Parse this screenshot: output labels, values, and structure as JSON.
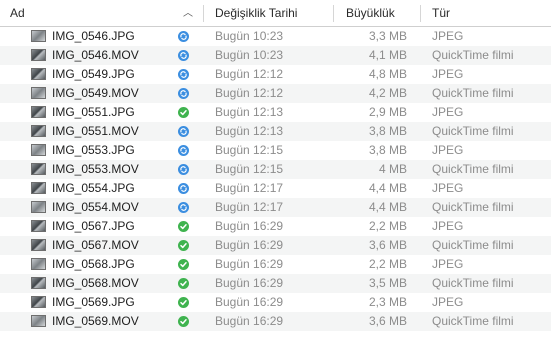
{
  "columns": {
    "name": "Ad",
    "date": "Değişiklik Tarihi",
    "size": "Büyüklük",
    "kind": "Tür",
    "sort_icon": "chevron-up-icon"
  },
  "colors": {
    "sync_blue": "#3b8ee0",
    "synced_green": "#3fb34f",
    "meta_text": "#8c8c8c"
  },
  "files": [
    {
      "name": "IMG_0546.JPG",
      "status": "syncing",
      "date": "Bugün 10:23",
      "size": "3,3 MB",
      "kind": "JPEG"
    },
    {
      "name": "IMG_0546.MOV",
      "status": "syncing",
      "date": "Bugün 10:23",
      "size": "4,1 MB",
      "kind": "QuickTime filmi"
    },
    {
      "name": "IMG_0549.JPG",
      "status": "syncing",
      "date": "Bugün 12:12",
      "size": "4,8 MB",
      "kind": "JPEG"
    },
    {
      "name": "IMG_0549.MOV",
      "status": "syncing",
      "date": "Bugün 12:12",
      "size": "4,2 MB",
      "kind": "QuickTime filmi"
    },
    {
      "name": "IMG_0551.JPG",
      "status": "synced",
      "date": "Bugün 12:13",
      "size": "2,9 MB",
      "kind": "JPEG"
    },
    {
      "name": "IMG_0551.MOV",
      "status": "syncing",
      "date": "Bugün 12:13",
      "size": "3,8 MB",
      "kind": "QuickTime filmi"
    },
    {
      "name": "IMG_0553.JPG",
      "status": "syncing",
      "date": "Bugün 12:15",
      "size": "3,8 MB",
      "kind": "JPEG"
    },
    {
      "name": "IMG_0553.MOV",
      "status": "syncing",
      "date": "Bugün 12:15",
      "size": "4 MB",
      "kind": "QuickTime filmi"
    },
    {
      "name": "IMG_0554.JPG",
      "status": "syncing",
      "date": "Bugün 12:17",
      "size": "4,4 MB",
      "kind": "JPEG"
    },
    {
      "name": "IMG_0554.MOV",
      "status": "syncing",
      "date": "Bugün 12:17",
      "size": "4,4 MB",
      "kind": "QuickTime filmi"
    },
    {
      "name": "IMG_0567.JPG",
      "status": "synced",
      "date": "Bugün 16:29",
      "size": "2,2 MB",
      "kind": "JPEG"
    },
    {
      "name": "IMG_0567.MOV",
      "status": "synced",
      "date": "Bugün 16:29",
      "size": "3,6 MB",
      "kind": "QuickTime filmi"
    },
    {
      "name": "IMG_0568.JPG",
      "status": "synced",
      "date": "Bugün 16:29",
      "size": "2,2 MB",
      "kind": "JPEG"
    },
    {
      "name": "IMG_0568.MOV",
      "status": "synced",
      "date": "Bugün 16:29",
      "size": "3,5 MB",
      "kind": "QuickTime filmi"
    },
    {
      "name": "IMG_0569.JPG",
      "status": "synced",
      "date": "Bugün 16:29",
      "size": "2,3 MB",
      "kind": "JPEG"
    },
    {
      "name": "IMG_0569.MOV",
      "status": "synced",
      "date": "Bugün 16:29",
      "size": "3,6 MB",
      "kind": "QuickTime filmi"
    }
  ]
}
